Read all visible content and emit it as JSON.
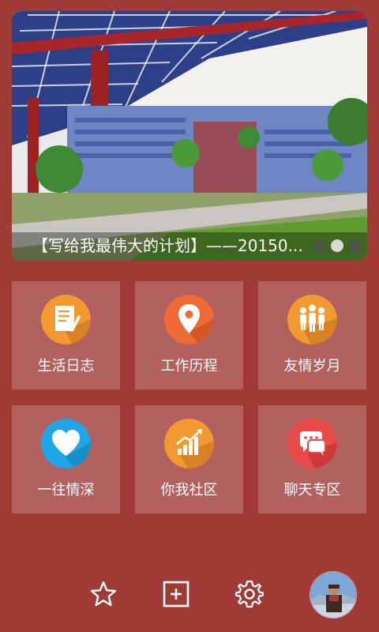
{
  "banner": {
    "title": "【写给我最伟大的计划】——20150...",
    "pager": {
      "count": 3,
      "active_index": 1
    }
  },
  "grid": {
    "tiles": [
      {
        "label": "生活日志",
        "icon": "diary-note-icon",
        "color": "#f29a30"
      },
      {
        "label": "工作历程",
        "icon": "location-pin-icon",
        "color": "#f06a35"
      },
      {
        "label": "友情岁月",
        "icon": "people-group-icon",
        "color": "#f29a30"
      },
      {
        "label": "一往情深",
        "icon": "heart-icon",
        "color": "#1ea6e6"
      },
      {
        "label": "你我社区",
        "icon": "growth-chart-icon",
        "color": "#f29a30"
      },
      {
        "label": "聊天专区",
        "icon": "chat-bubbles-icon",
        "color": "#e84a4a"
      }
    ]
  },
  "bottom_bar": {
    "items": [
      "star-icon",
      "add-box-icon",
      "settings-gear-icon",
      "user-avatar"
    ]
  },
  "colors": {
    "background": "#a03a37",
    "tile": "#b4615e"
  }
}
